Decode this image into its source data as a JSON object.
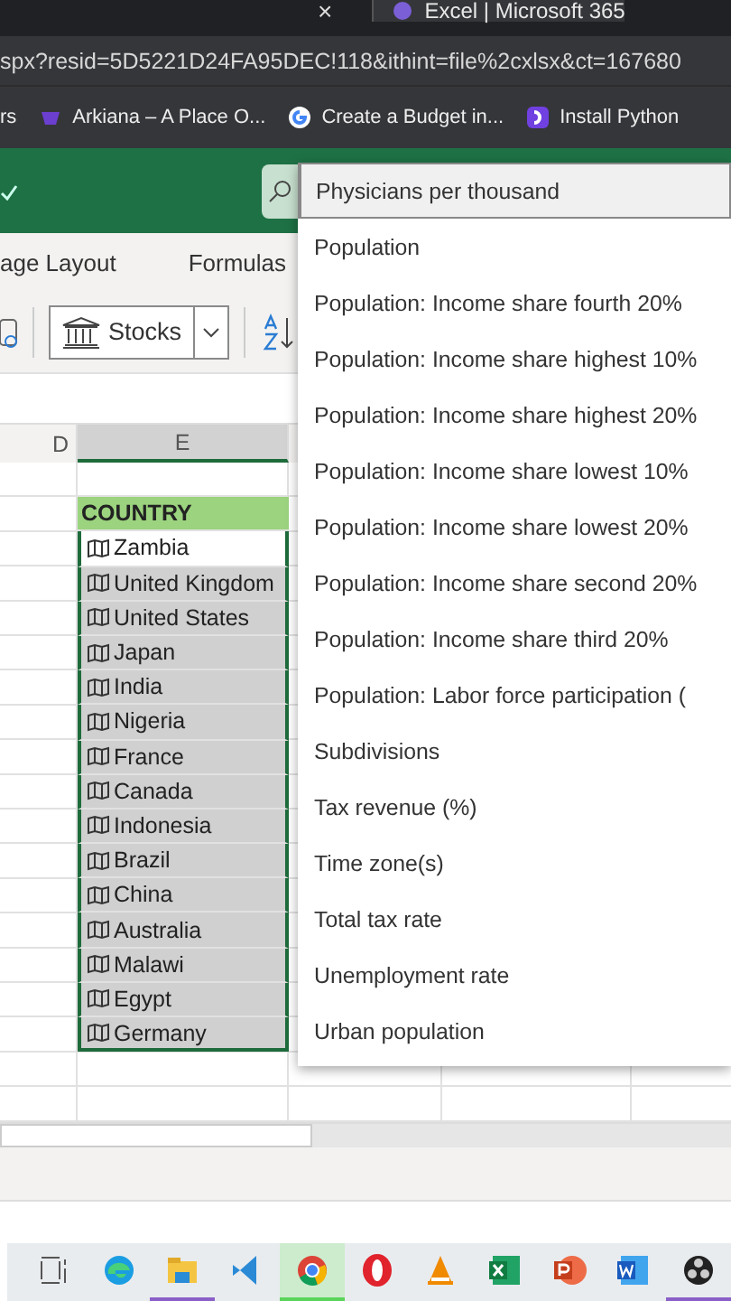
{
  "browser": {
    "tabs": [
      {
        "title": "Excel | Microsoft 365",
        "selected": true
      }
    ],
    "close": "×",
    "address": "spx?resid=5D5221D24FA95DEC!118&ithint=file%2cxlsx&ct=167680",
    "bookmarks": [
      {
        "label": "rs",
        "kind": "none"
      },
      {
        "label": "Arkiana – A Place O...",
        "kind": "arkiana"
      },
      {
        "label": "Create a Budget in...",
        "kind": "google"
      },
      {
        "label": "Install Python",
        "kind": "python"
      }
    ]
  },
  "ribbon": {
    "tabs": [
      "age Layout",
      "Formulas"
    ],
    "data_type": "Stocks"
  },
  "sheet": {
    "columns": [
      "D",
      "E"
    ],
    "header": "COUNTRY",
    "rows": [
      {
        "name": "Zambia",
        "active": true
      },
      {
        "name": "United Kingdom",
        "active": false
      },
      {
        "name": "United States",
        "active": false
      },
      {
        "name": "Japan",
        "active": false
      },
      {
        "name": "India",
        "active": false
      },
      {
        "name": "Nigeria",
        "active": false
      },
      {
        "name": "France",
        "active": false
      },
      {
        "name": "Canada",
        "active": false
      },
      {
        "name": "Indonesia",
        "active": false
      },
      {
        "name": "Brazil",
        "active": false
      },
      {
        "name": "China",
        "active": false
      },
      {
        "name": "Australia",
        "active": false
      },
      {
        "name": "Malawi",
        "active": false
      },
      {
        "name": "Egypt",
        "active": false
      },
      {
        "name": "Germany",
        "active": false
      }
    ]
  },
  "dropdown": {
    "items": [
      {
        "label": "Physicians per thousand",
        "selected": true
      },
      {
        "label": "Population",
        "selected": false
      },
      {
        "label": "Population: Income share fourth 20%",
        "selected": false
      },
      {
        "label": "Population: Income share highest 10%",
        "selected": false
      },
      {
        "label": "Population: Income share highest 20%",
        "selected": false
      },
      {
        "label": "Population: Income share lowest 10%",
        "selected": false
      },
      {
        "label": "Population: Income share lowest 20%",
        "selected": false
      },
      {
        "label": "Population: Income share second 20%",
        "selected": false
      },
      {
        "label": "Population: Income share third 20%",
        "selected": false
      },
      {
        "label": "Population: Labor force participation (",
        "selected": false
      },
      {
        "label": "Subdivisions",
        "selected": false
      },
      {
        "label": "Tax revenue (%)",
        "selected": false
      },
      {
        "label": "Time zone(s)",
        "selected": false
      },
      {
        "label": "Total tax rate",
        "selected": false
      },
      {
        "label": "Unemployment rate",
        "selected": false
      },
      {
        "label": "Urban population",
        "selected": false
      }
    ]
  },
  "taskbar": {
    "apps": [
      {
        "kind": "taskview",
        "running": false,
        "selected": false
      },
      {
        "kind": "edge",
        "running": false,
        "selected": false
      },
      {
        "kind": "folder",
        "running": true,
        "selected": false
      },
      {
        "kind": "vscode",
        "running": false,
        "selected": false
      },
      {
        "kind": "chrome",
        "running": false,
        "selected": true
      },
      {
        "kind": "opera",
        "running": false,
        "selected": false
      },
      {
        "kind": "vlc",
        "running": false,
        "selected": false
      },
      {
        "kind": "excel",
        "running": false,
        "selected": false
      },
      {
        "kind": "powerpoint",
        "running": false,
        "selected": false
      },
      {
        "kind": "word",
        "running": false,
        "selected": false
      },
      {
        "kind": "obs",
        "running": true,
        "selected": false
      }
    ]
  }
}
